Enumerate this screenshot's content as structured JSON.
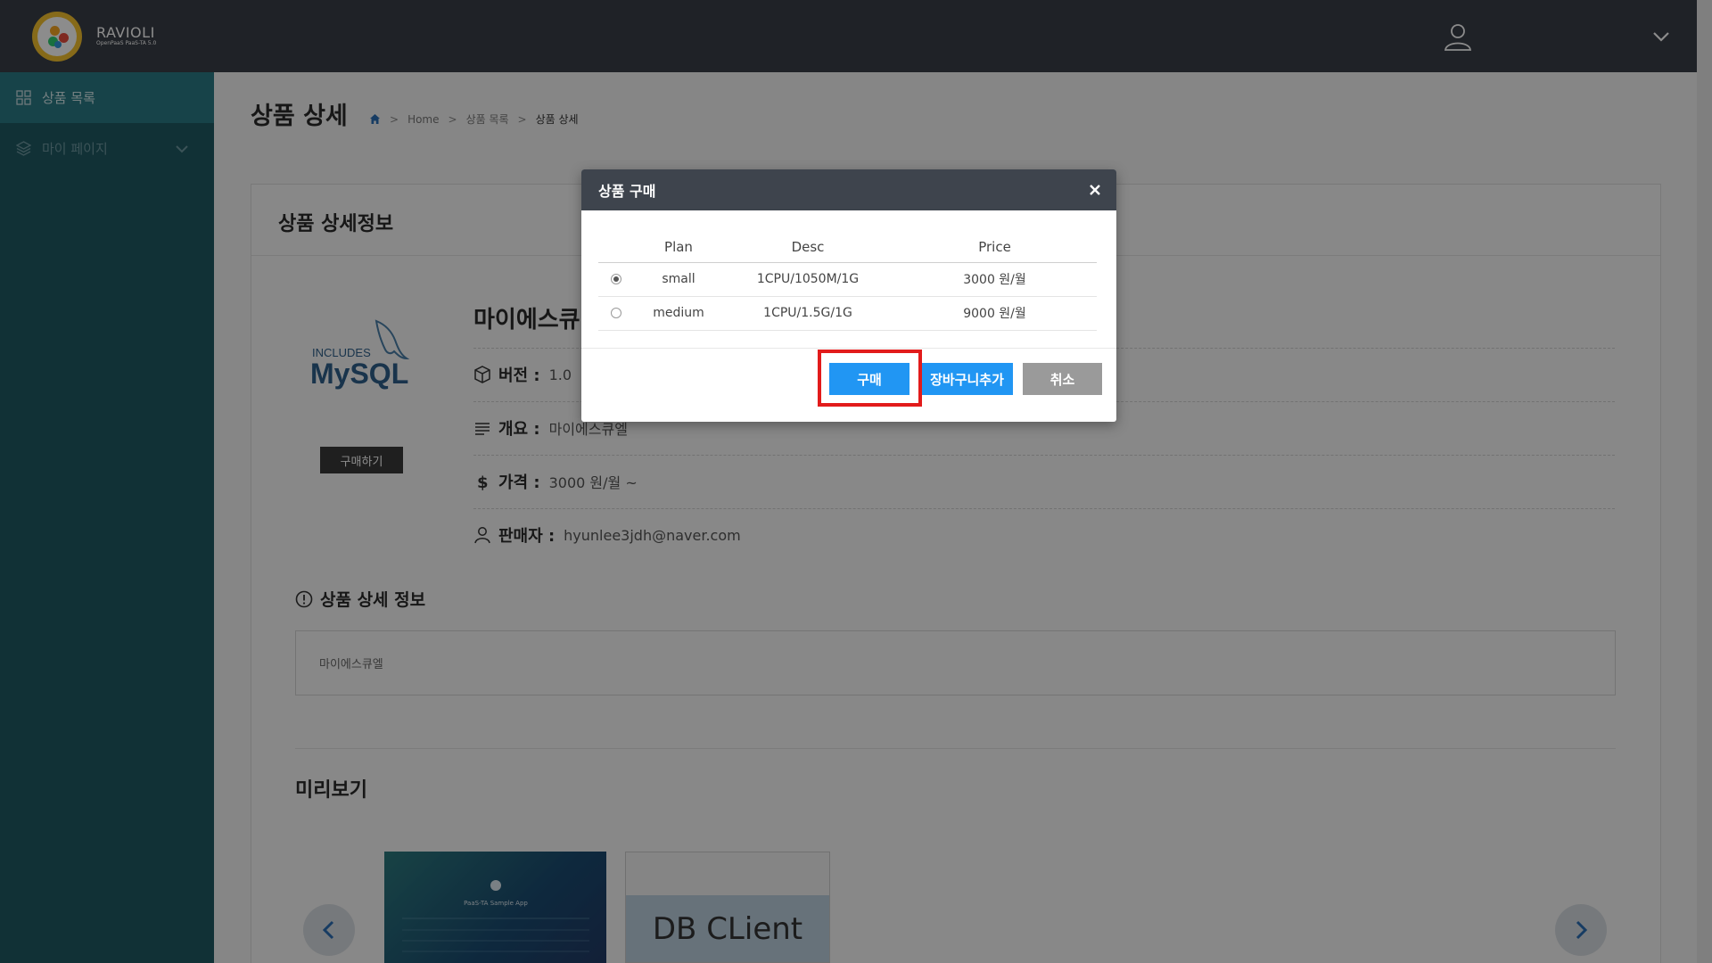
{
  "header": {
    "logo_name": "RAVIOLI",
    "logo_sub": "OpenPaaS PaaS-TA 5.0"
  },
  "sidebar": {
    "items": [
      {
        "label": "상품 목록",
        "icon": "grid-icon",
        "active": true
      },
      {
        "label": "마이 페이지",
        "icon": "layers-icon",
        "active": false
      }
    ]
  },
  "page": {
    "title": "상품 상세",
    "breadcrumb": [
      "Home",
      "상품 목록",
      "상품 상세"
    ]
  },
  "card": {
    "title": "상품 상세정보",
    "product_name": "마이에스큐",
    "buy_button": "구매하기",
    "version_label": "버전 :",
    "version_value": "1.0",
    "summary_label": "개요 :",
    "summary_value": "마이에스큐엘",
    "price_label": "가격 :",
    "price_value": "3000 원/월 ~",
    "seller_label": "판매자 :",
    "seller_value": "hyunlee3jdh@naver.com",
    "detail_title": "상품 상세 정보",
    "detail_text": "마이에스큐엘",
    "preview_title": "미리보기",
    "thumb1_caption": "PaaS-TA Sample App",
    "thumb2_caption": "DB CLient",
    "logo_text_top": "INCLUDES",
    "logo_text_main": "MySQL"
  },
  "modal": {
    "title": "상품 구매",
    "columns": [
      "Plan",
      "Desc",
      "Price"
    ],
    "rows": [
      {
        "plan": "small",
        "desc": "1CPU/1050M/1G",
        "price": "3000 원/월",
        "selected": true
      },
      {
        "plan": "medium",
        "desc": "1CPU/1.5G/1G",
        "price": "9000 원/월",
        "selected": false
      }
    ],
    "buy_label": "구매",
    "cart_label": "장바구니추가",
    "cancel_label": "취소"
  },
  "colors": {
    "topbar": "#3a3f47",
    "sidebar": "#1f5a63",
    "sidebar_active": "#2b7a86",
    "primary_button": "#2196f3",
    "highlight": "#e21b1b"
  }
}
